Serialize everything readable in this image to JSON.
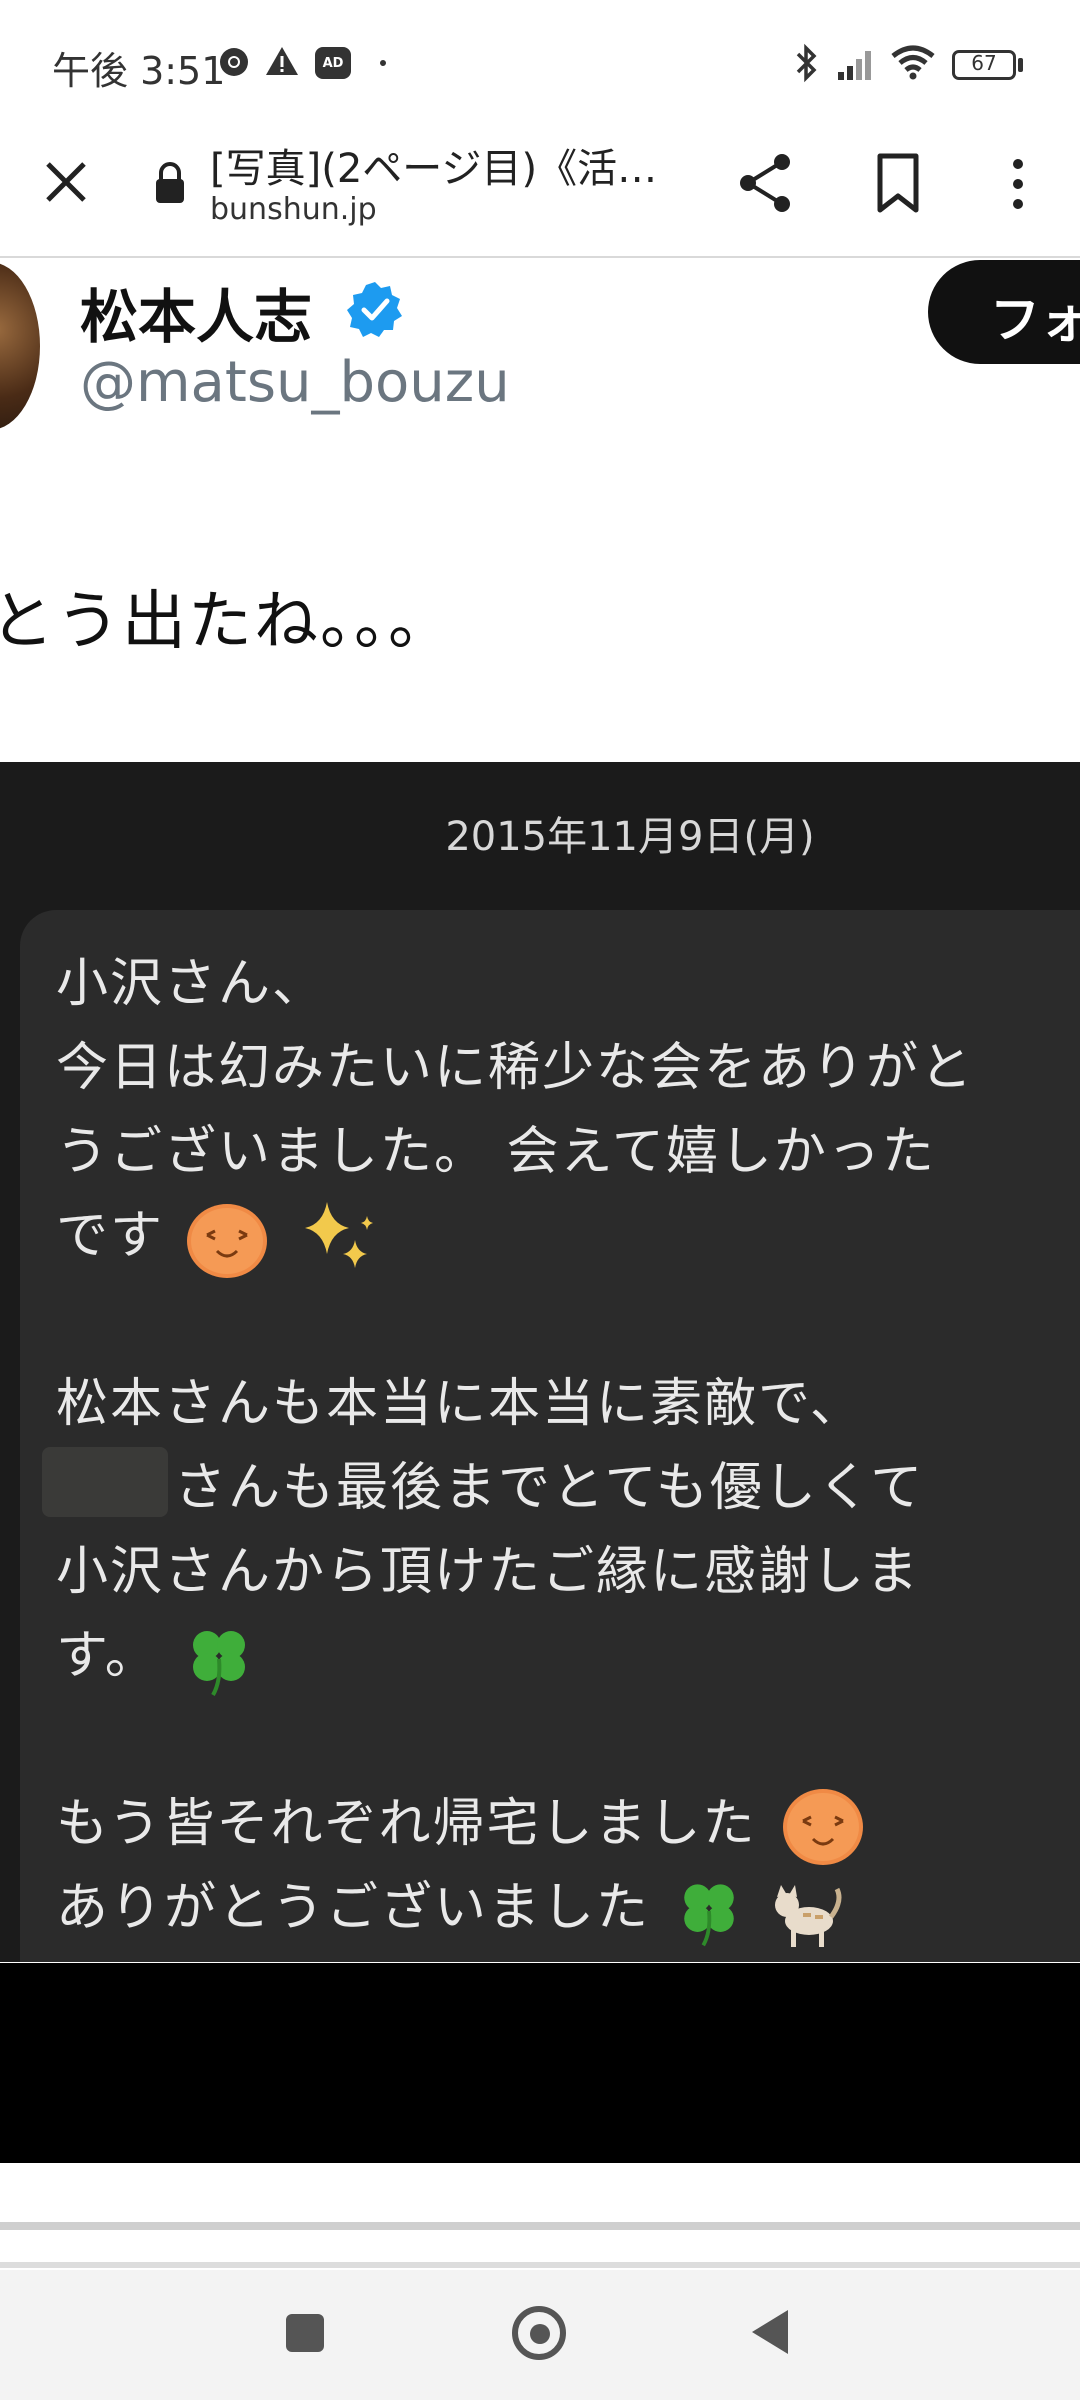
{
  "status_bar": {
    "time": "午後 3:51",
    "battery": "67",
    "icons": [
      "chrome-icon",
      "warning-icon",
      "ad-blocker-icon",
      "dot-icon",
      "bluetooth-icon",
      "signal-icon",
      "wifi-icon",
      "battery-icon"
    ]
  },
  "browser": {
    "page_title": "[写真](2ページ目)《活…",
    "url": "bunshun.jp"
  },
  "tweet": {
    "author_name": "松本人志",
    "handle": "@matsu_bouzu",
    "follow_label": "フォ",
    "text": "とう出たね。。。"
  },
  "chat": {
    "date": "2015年11月9日(月)",
    "lines": [
      "小沢さん、",
      "今日は幻みたいに稀少な会をありがと",
      "うございました。 会えて嬉しかった",
      "です",
      "",
      "松本さんも本当に本当に素敵で、",
      "さんも最後までとても優しくて",
      "小沢さんから頂けたご縁に感謝しま",
      "す。",
      "",
      "もう皆それぞれ帰宅しました",
      "ありがとうございました"
    ]
  },
  "colors": {
    "verified_blue": "#1d9bf0",
    "chat_background": "#1b1b1b",
    "bubble_background": "#2b2b2b"
  }
}
